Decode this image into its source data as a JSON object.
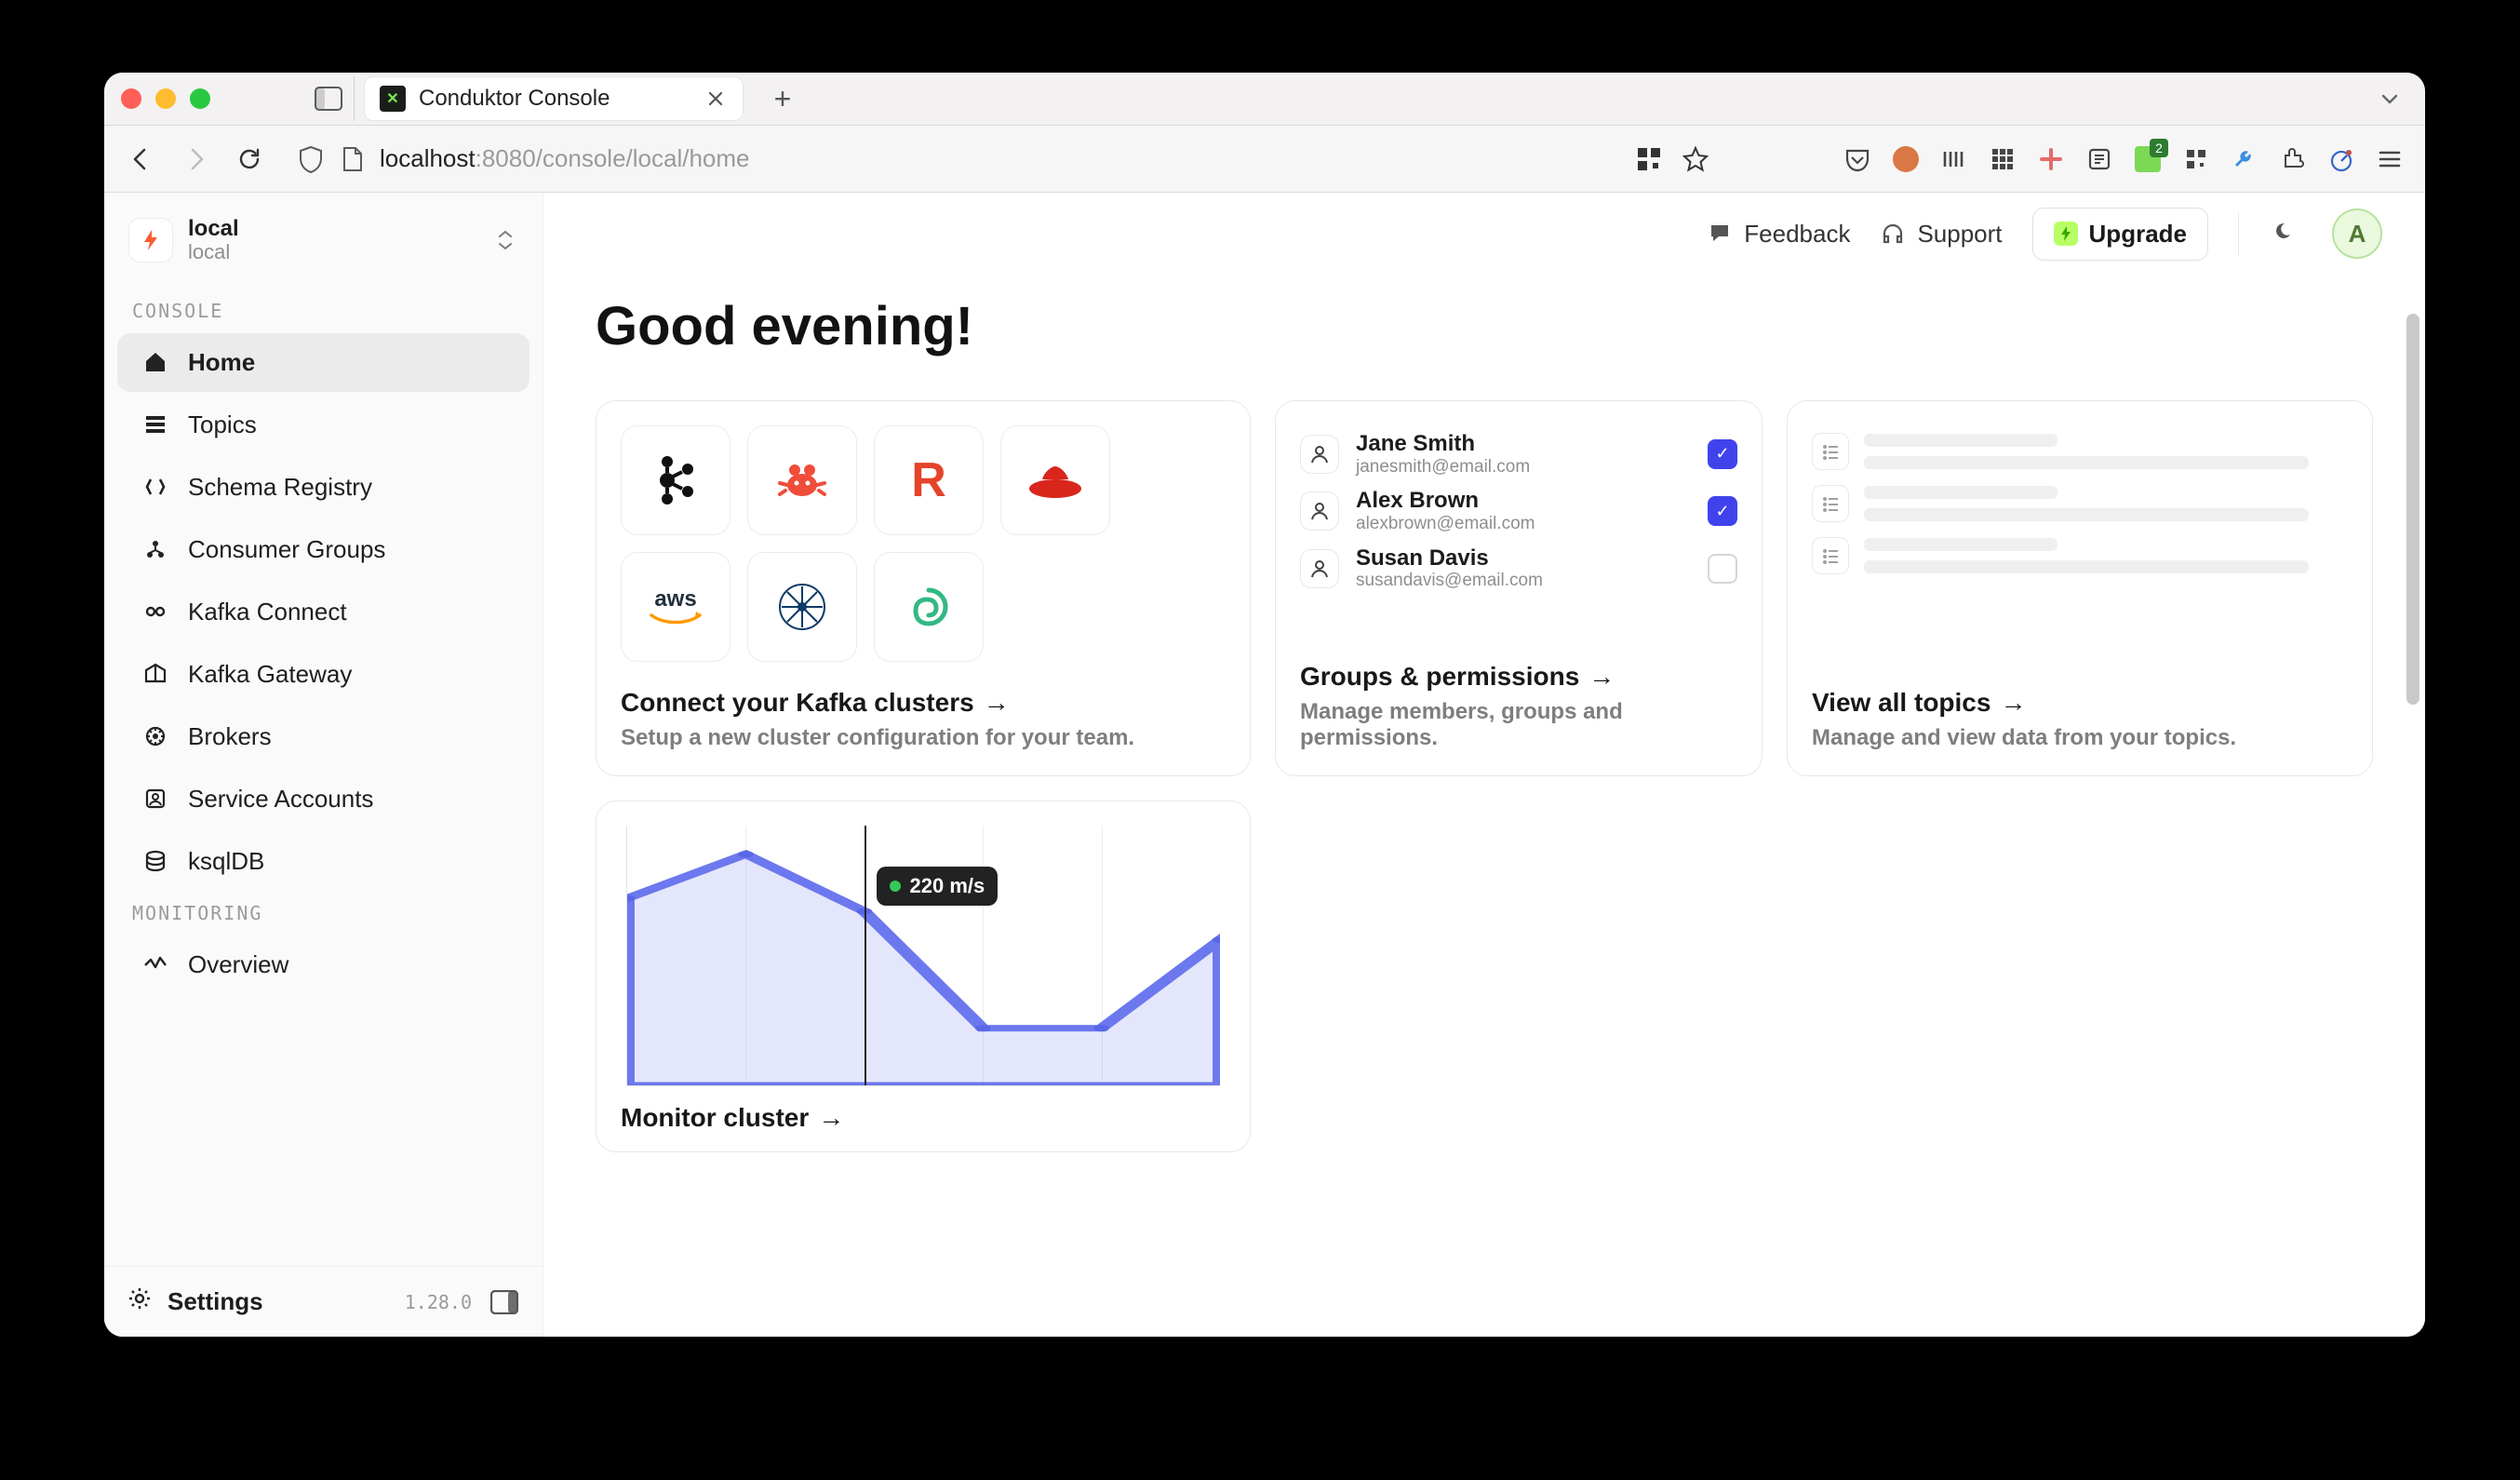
{
  "browser": {
    "tab_title": "Conduktor Console",
    "url_host": "localhost",
    "url_port_path": ":8080/console/local/home",
    "extension_badge": "2"
  },
  "sidebar": {
    "cluster_name": "local",
    "cluster_sub": "local",
    "section_console": "CONSOLE",
    "section_monitoring": "MONITORING",
    "items": [
      {
        "label": "Home",
        "icon": "home"
      },
      {
        "label": "Topics",
        "icon": "topics"
      },
      {
        "label": "Schema Registry",
        "icon": "schema"
      },
      {
        "label": "Consumer Groups",
        "icon": "groups"
      },
      {
        "label": "Kafka Connect",
        "icon": "connect"
      },
      {
        "label": "Kafka Gateway",
        "icon": "gateway"
      },
      {
        "label": "Brokers",
        "icon": "brokers"
      },
      {
        "label": "Service Accounts",
        "icon": "accounts"
      },
      {
        "label": "ksqlDB",
        "icon": "ksql"
      }
    ],
    "monitoring_items": [
      {
        "label": "Overview",
        "icon": "overview"
      }
    ],
    "settings_label": "Settings",
    "version": "1.28.0"
  },
  "topbar": {
    "feedback": "Feedback",
    "support": "Support",
    "upgrade": "Upgrade",
    "avatar_initial": "A"
  },
  "main": {
    "greeting": "Good evening!"
  },
  "cards": {
    "connect": {
      "title": "Connect your Kafka clusters",
      "subtitle": "Setup a new cluster configuration for your team.",
      "logos": [
        "kafka",
        "crab",
        "redpanda",
        "redhat",
        "aws",
        "confluent",
        "spiral"
      ]
    },
    "groups": {
      "title": "Groups & permissions",
      "subtitle": "Manage members, groups and permissions.",
      "users": [
        {
          "name": "Jane Smith",
          "email": "janesmith@email.com",
          "checked": true
        },
        {
          "name": "Alex Brown",
          "email": "alexbrown@email.com",
          "checked": true
        },
        {
          "name": "Susan Davis",
          "email": "susandavis@email.com",
          "checked": false
        }
      ]
    },
    "topics": {
      "title": "View all topics",
      "subtitle": "Manage and view data from your topics."
    },
    "monitor": {
      "title": "Monitor cluster",
      "tooltip": "220 m/s"
    }
  },
  "chart_data": {
    "type": "line",
    "x": [
      0,
      1,
      2,
      3,
      4,
      5
    ],
    "values": [
      230,
      260,
      220,
      140,
      140,
      200
    ],
    "cursor_x": 2,
    "tooltip_value": "220 m/s",
    "ylim": [
      100,
      280
    ],
    "ylabel": "m/s",
    "fill": true
  },
  "colors": {
    "accent_blue": "#4043ec",
    "chart_line": "#6c78ee",
    "chart_fill": "rgba(108,120,238,0.18)",
    "upgrade_bolt_bg": "#b7ff64"
  }
}
